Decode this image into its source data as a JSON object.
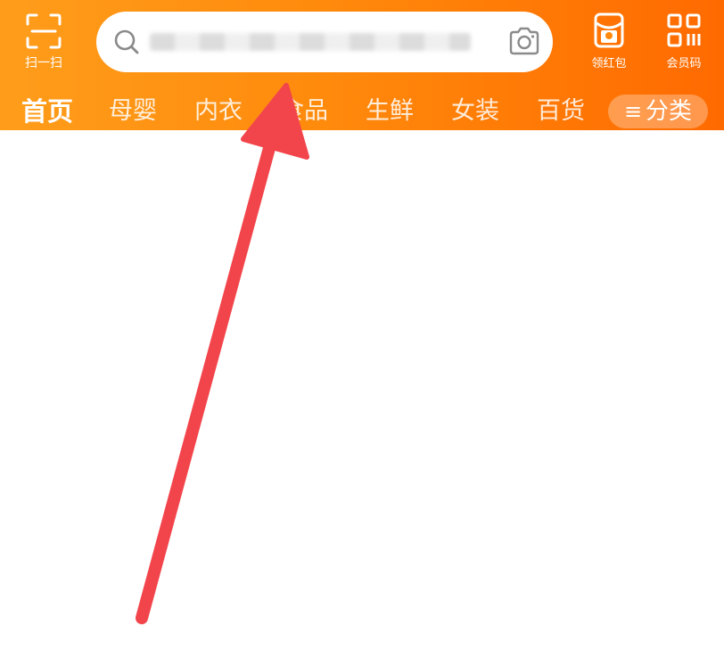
{
  "header": {
    "scan_label": "扫一扫",
    "red_packet_label": "领红包",
    "member_code_label": "会员码",
    "colors": {
      "gradient_start": "#ff9d1b",
      "gradient_end": "#ff6a00"
    }
  },
  "search": {
    "icon": "search-icon",
    "camera_icon": "camera-icon"
  },
  "tabs": [
    {
      "label": "首页",
      "active": true
    },
    {
      "label": "母婴"
    },
    {
      "label": "内衣"
    },
    {
      "label": "食品"
    },
    {
      "label": "生鲜"
    },
    {
      "label": "女装"
    },
    {
      "label": "百货"
    }
  ],
  "category_button": {
    "icon": "menu-icon",
    "label": "分类"
  },
  "annotation": {
    "icon": "red-arrow",
    "color": "#f2454b"
  }
}
